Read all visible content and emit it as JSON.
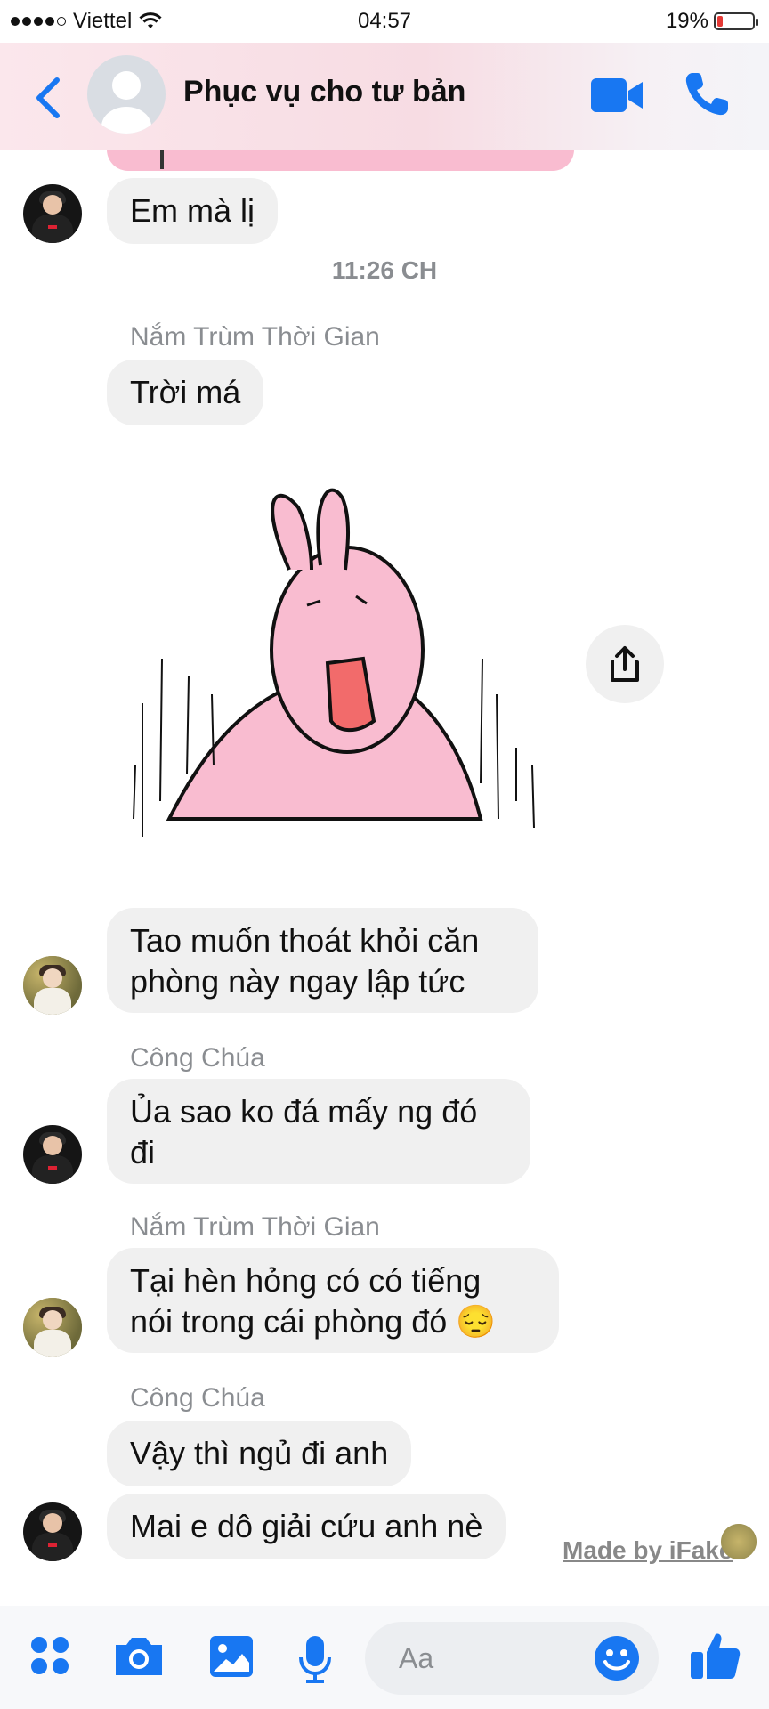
{
  "status_bar": {
    "carrier": "Viettel",
    "time": "04:57",
    "battery_percent": "19%",
    "battery_level": 0.19
  },
  "header": {
    "title": "Phục vụ cho tư bản",
    "icons": [
      "back-chevron-icon",
      "video-call-icon",
      "phone-call-icon"
    ],
    "accent_color": "#1877f2"
  },
  "messages": {
    "m1": "Em mà lị",
    "timestamp": "11:26 CH",
    "sender1": "Nắm Trùm Thời Gian",
    "m2": "Trời má",
    "m3": "Tao muốn thoát khỏi căn\nphòng này ngay lập tức",
    "sender2": "Công Chúa",
    "m4": "Ủa sao ko đá mấy ng đó\nđi",
    "sender3": "Nắm Trùm Thời Gian",
    "m5": "Tại hèn hỏng có có tiếng\nnói trong cái phòng đó 😔",
    "sender4": "Công Chúa",
    "m6": "Vậy thì ngủ đi anh",
    "m7": "Mai e dô giải cứu anh nè"
  },
  "watermark": "Made by iFake",
  "composer": {
    "placeholder": "Aa"
  }
}
